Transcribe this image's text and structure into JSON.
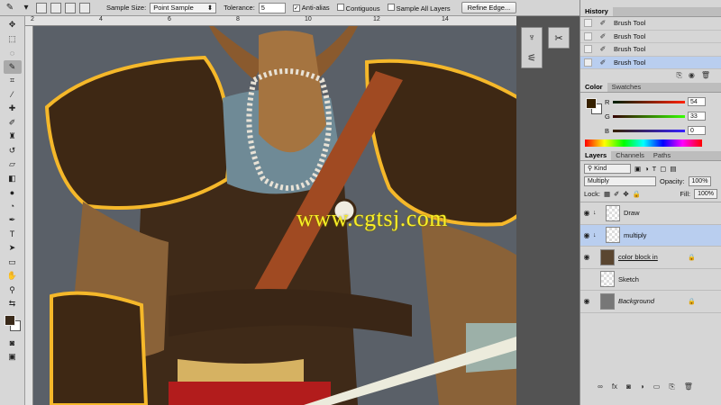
{
  "options_bar": {
    "sample_size_label": "Sample Size:",
    "sample_size_value": "Point Sample",
    "tolerance_label": "Tolerance:",
    "tolerance_value": "5",
    "anti_alias_label": "Anti-alias",
    "anti_alias_checked": true,
    "contiguous_label": "Contiguous",
    "sample_all_layers_label": "Sample All Layers",
    "refine_edge_label": "Refine Edge..."
  },
  "ruler_top": [
    "2",
    "4",
    "6",
    "8",
    "10",
    "12",
    "14"
  ],
  "canvas": {
    "watermark": "www.cgtsj.com"
  },
  "history": {
    "tab": "History",
    "items": [
      "Brush Tool",
      "Brush Tool",
      "Brush Tool",
      "Brush Tool"
    ],
    "selected_index": 3
  },
  "color": {
    "tabs": [
      "Color",
      "Swatches"
    ],
    "r_label": "R",
    "r_value": "54",
    "g_label": "G",
    "g_value": "33",
    "b_label": "B",
    "b_value": "0",
    "foreground": "#362100"
  },
  "layers": {
    "tabs": [
      "Layers",
      "Channels",
      "Paths"
    ],
    "filter_kind": "Kind",
    "blend_mode": "Multiply",
    "opacity_label": "Opacity:",
    "opacity_value": "100%",
    "lock_label": "Lock:",
    "fill_label": "Fill:",
    "fill_value": "100%",
    "items": [
      {
        "name": "Draw",
        "visible": true
      },
      {
        "name": "multiply",
        "visible": true
      },
      {
        "name": "color block in",
        "visible": true
      },
      {
        "name": "Sketch",
        "visible": false
      },
      {
        "name": "Background",
        "visible": true
      }
    ]
  }
}
